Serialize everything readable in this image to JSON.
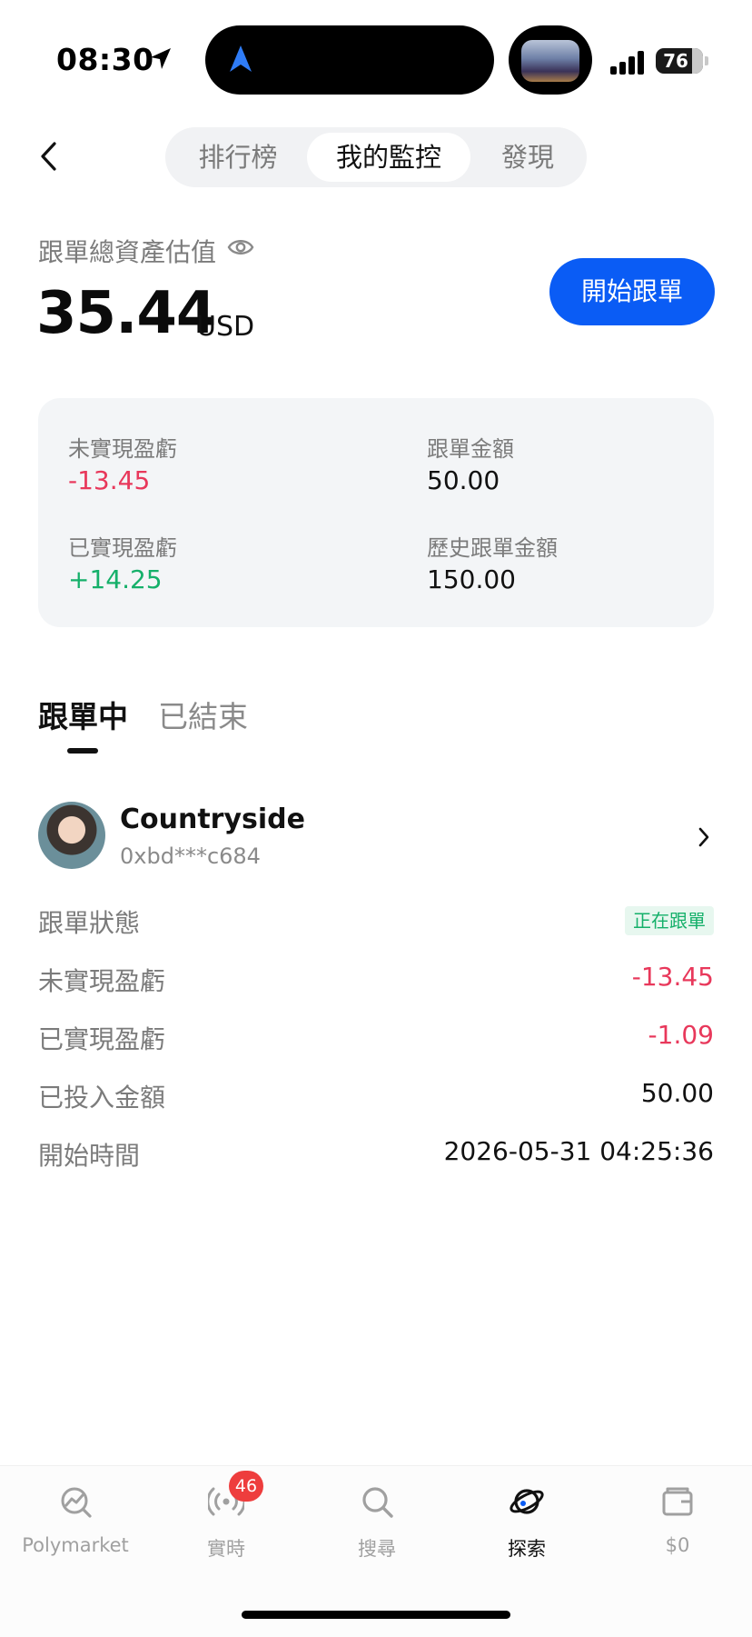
{
  "status_bar": {
    "time": "08:30",
    "battery": "76"
  },
  "header": {
    "tabs": [
      {
        "label": "排行榜"
      },
      {
        "label": "我的監控"
      },
      {
        "label": "發現"
      }
    ],
    "active_tab": "我的監控"
  },
  "assets": {
    "label": "跟單總資產估值",
    "value": "35.44",
    "unit": "USD",
    "start_button": "開始跟單"
  },
  "summary": {
    "unrealized_label": "未實現盈虧",
    "unrealized_value": "-13.45",
    "follow_amount_label": "跟單金額",
    "follow_amount_value": "50.00",
    "realized_label": "已實現盈虧",
    "realized_value": "+14.25",
    "history_amount_label": "歷史跟單金額",
    "history_amount_value": "150.00"
  },
  "tabs": {
    "active": "跟單中",
    "inactive": "已結束"
  },
  "trader": {
    "name": "Countryside",
    "address": "0xbd***c684",
    "rows": [
      {
        "label": "跟單狀態",
        "value": "正在跟單"
      },
      {
        "label": "未實現盈虧",
        "value": "-13.45"
      },
      {
        "label": "已實現盈虧",
        "value": "-1.09"
      },
      {
        "label": "已投入金額",
        "value": "50.00"
      },
      {
        "label": "開始時間",
        "value": "2026-05-31 04:25:36"
      }
    ]
  },
  "bottom_nav": {
    "items": [
      {
        "label": "Polymarket",
        "icon": "polymarket-icon"
      },
      {
        "label": "實時",
        "icon": "live-broadcast-icon",
        "badge": "46"
      },
      {
        "label": "搜尋",
        "icon": "search-icon"
      },
      {
        "label": "探索",
        "icon": "planet-icon"
      },
      {
        "label": "$0",
        "icon": "wallet-icon"
      }
    ],
    "active": "探索"
  },
  "colors": {
    "accent": "#0a5cf5",
    "negative": "#e8385b",
    "positive": "#15b06a"
  }
}
